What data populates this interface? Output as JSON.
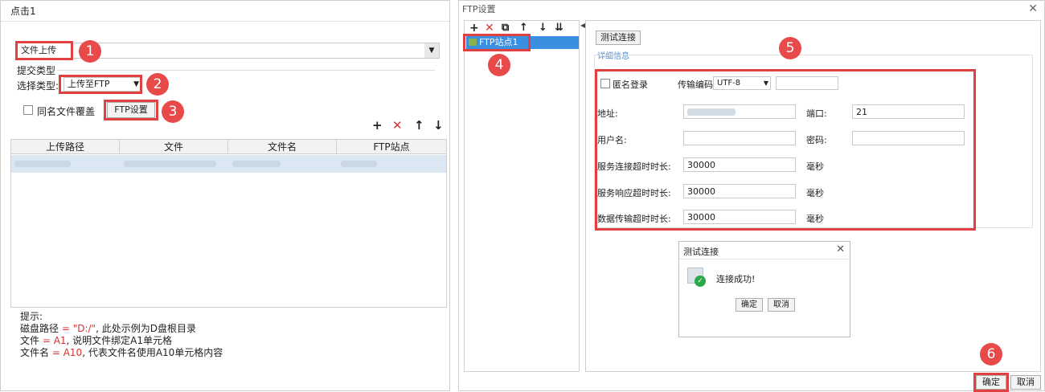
{
  "left_dialog": {
    "title": "点击1",
    "action_select": "文件上传",
    "submit_type_label": "提交类型",
    "select_type_label": "选择类型:",
    "select_type_value": "上传至FTP",
    "overwrite_label": "同名文件覆盖",
    "ftp_settings_button": "FTP设置",
    "table_headers": [
      "上传路径",
      "文件",
      "文件名",
      "FTP站点"
    ],
    "hint_title": "提示:",
    "hint_line1_prefix": "磁盘路径",
    "hint_line1_eq": " = \"D:/\"",
    "hint_line1_suffix": ", 此处示例为D盘根目录",
    "hint_line2_prefix": "文件",
    "hint_line2_eq": " = A1",
    "hint_line2_suffix": ", 说明文件绑定A1单元格",
    "hint_line3_prefix": "文件名",
    "hint_line3_eq": " = A10",
    "hint_line3_suffix": ", 代表文件名使用A10单元格内容"
  },
  "ftp_dialog": {
    "title": "FTP设置",
    "site_item": "FTP站点1",
    "test_button": "测试连接",
    "section_label": "详细信息",
    "anonymous_label": "匿名登录",
    "encoding_label": "传输编码",
    "encoding_value": "UTF-8",
    "address_label": "地址:",
    "port_label": "端口:",
    "port_value": "21",
    "username_label": "用户名:",
    "password_label": "密码:",
    "connect_timeout_label": "服务连接超时时长:",
    "connect_timeout_value": "30000",
    "response_timeout_label": "服务响应超时时长:",
    "response_timeout_value": "30000",
    "transfer_timeout_label": "数据传输超时时长:",
    "transfer_timeout_value": "30000",
    "ms_unit": "毫秒",
    "ok_button": "确定",
    "cancel_button": "取消"
  },
  "test_popup": {
    "title": "测试连接",
    "message": "连接成功!",
    "ok_button": "确定",
    "cancel_button": "取消"
  },
  "badges": [
    "1",
    "2",
    "3",
    "4",
    "5",
    "6"
  ],
  "colors": {
    "highlight_red": "#e04040",
    "selection_blue": "#3b8fe0",
    "success_green": "#2aa84a"
  }
}
